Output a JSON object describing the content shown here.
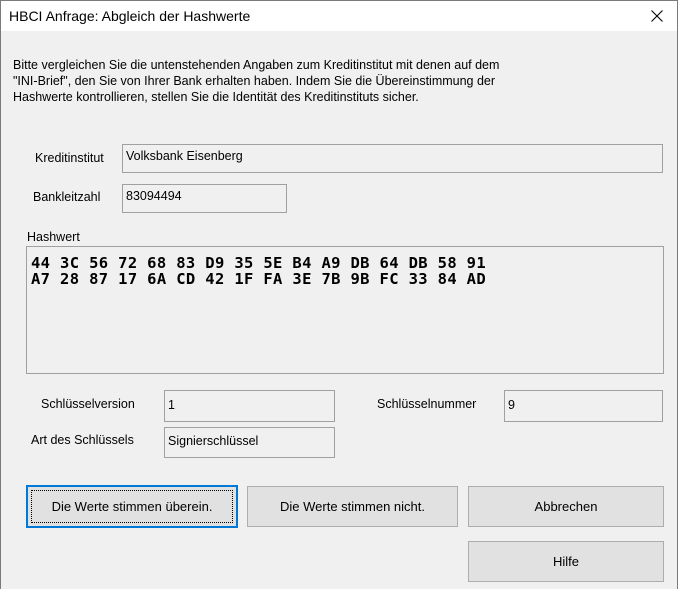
{
  "window": {
    "title": "HBCI Anfrage: Abgleich der Hashwerte",
    "close_icon": "close-icon"
  },
  "intro_text": "Bitte vergleichen Sie die untenstehenden Angaben zum Kreditinstitut mit denen auf dem\n\"INI-Brief\", den Sie von Ihrer Bank erhalten haben. Indem Sie die Übereinstimmung der\nHashwerte kontrollieren, stellen Sie die Identität des Kreditinstituts sicher.",
  "bank": {
    "kreditinstitut_label": "Kreditinstitut",
    "kreditinstitut_value": "Volksbank Eisenberg",
    "bankleitzahl_label": "Bankleitzahl",
    "bankleitzahl_value": "83094494"
  },
  "hash": {
    "label": "Hashwert",
    "lines": [
      "44 3C 56 72 68 83 D9 35 5E B4 A9 DB 64 DB 58 91",
      "A7 28 87 17 6A CD 42 1F FA 3E 7B 9B FC 33 84 AD"
    ]
  },
  "key": {
    "version_label": "Schlüsselversion",
    "version_value": "1",
    "number_label": "Schlüsselnummer",
    "number_value": "9",
    "type_label": "Art des Schlüssels",
    "type_value": "Signierschlüssel"
  },
  "buttons": {
    "match": "Die Werte stimmen überein.",
    "no_match": "Die Werte stimmen nicht.",
    "cancel": "Abbrechen",
    "help": "Hilfe"
  },
  "colors": {
    "dialog_background": "#f0f0f0",
    "titlebar_background": "#ffffff",
    "focus_border": "#0078d7",
    "button_background": "#e1e1e1"
  }
}
